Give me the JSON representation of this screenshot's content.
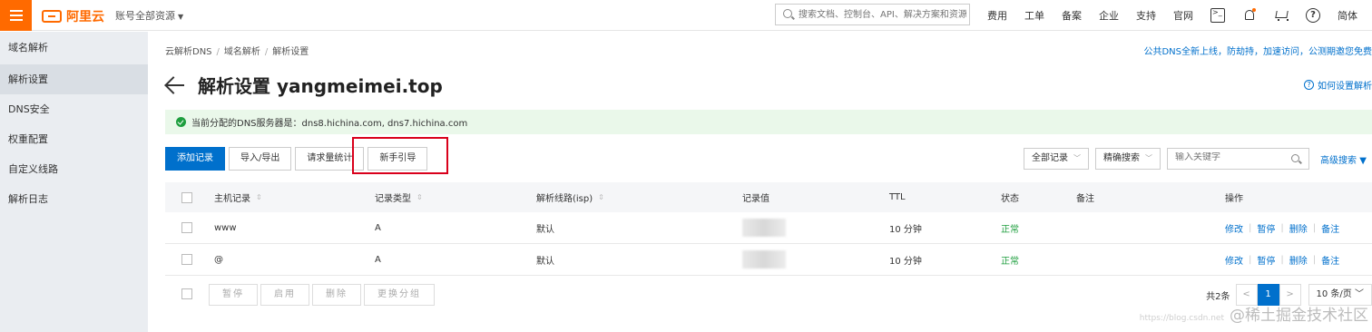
{
  "topbar": {
    "logo_text": "阿里云",
    "account_label": "账号全部资源",
    "search_placeholder": "搜索文档、控制台、API、解决方案和资源",
    "nav": [
      "费用",
      "工单",
      "备案",
      "企业",
      "支持",
      "官网"
    ],
    "lang": "简体",
    "accent": "#ff6a00"
  },
  "sidebar": {
    "items": [
      "域名解析",
      "解析设置",
      "DNS安全",
      "权重配置",
      "自定义线路",
      "解析日志"
    ],
    "active_index": 1
  },
  "breadcrumb": [
    "云解析DNS",
    "域名解析",
    "解析设置"
  ],
  "announcement": "公共DNS全新上线，防劫持，加速访问，公测期邀您免费",
  "page_title": "解析设置 yangmeimei.top",
  "howto_link": "如何设置解析",
  "dns_notice": "当前分配的DNS服务器是：dns8.hichina.com, dns7.hichina.com",
  "toolbar": {
    "add": "添加记录",
    "import_export": "导入/导出",
    "stats": "请求量统计",
    "guide": "新手引导"
  },
  "filters": {
    "all_records": "全部记录",
    "exact_search": "精确搜索",
    "keyword_placeholder": "输入关键字",
    "advanced": "高级搜索"
  },
  "table": {
    "headers": [
      "主机记录",
      "记录类型",
      "解析线路(isp)",
      "记录值",
      "TTL",
      "状态",
      "备注",
      "操作"
    ],
    "rows": [
      {
        "host": "www",
        "type": "A",
        "line": "默认",
        "ttl": "10 分钟",
        "status": "正常"
      },
      {
        "host": "@",
        "type": "A",
        "line": "默认",
        "ttl": "10 分钟",
        "status": "正常"
      }
    ],
    "actions": [
      "修改",
      "暂停",
      "删除",
      "备注"
    ]
  },
  "bulk": [
    "暂停",
    "启用",
    "删除",
    "更换分组"
  ],
  "pager": {
    "total": "共2条",
    "prev": "<",
    "page": "1",
    "next": ">",
    "size": "10 条/页"
  },
  "watermark": {
    "url": "https://blog.csdn.net",
    "text": "@稀土掘金技术社区"
  }
}
